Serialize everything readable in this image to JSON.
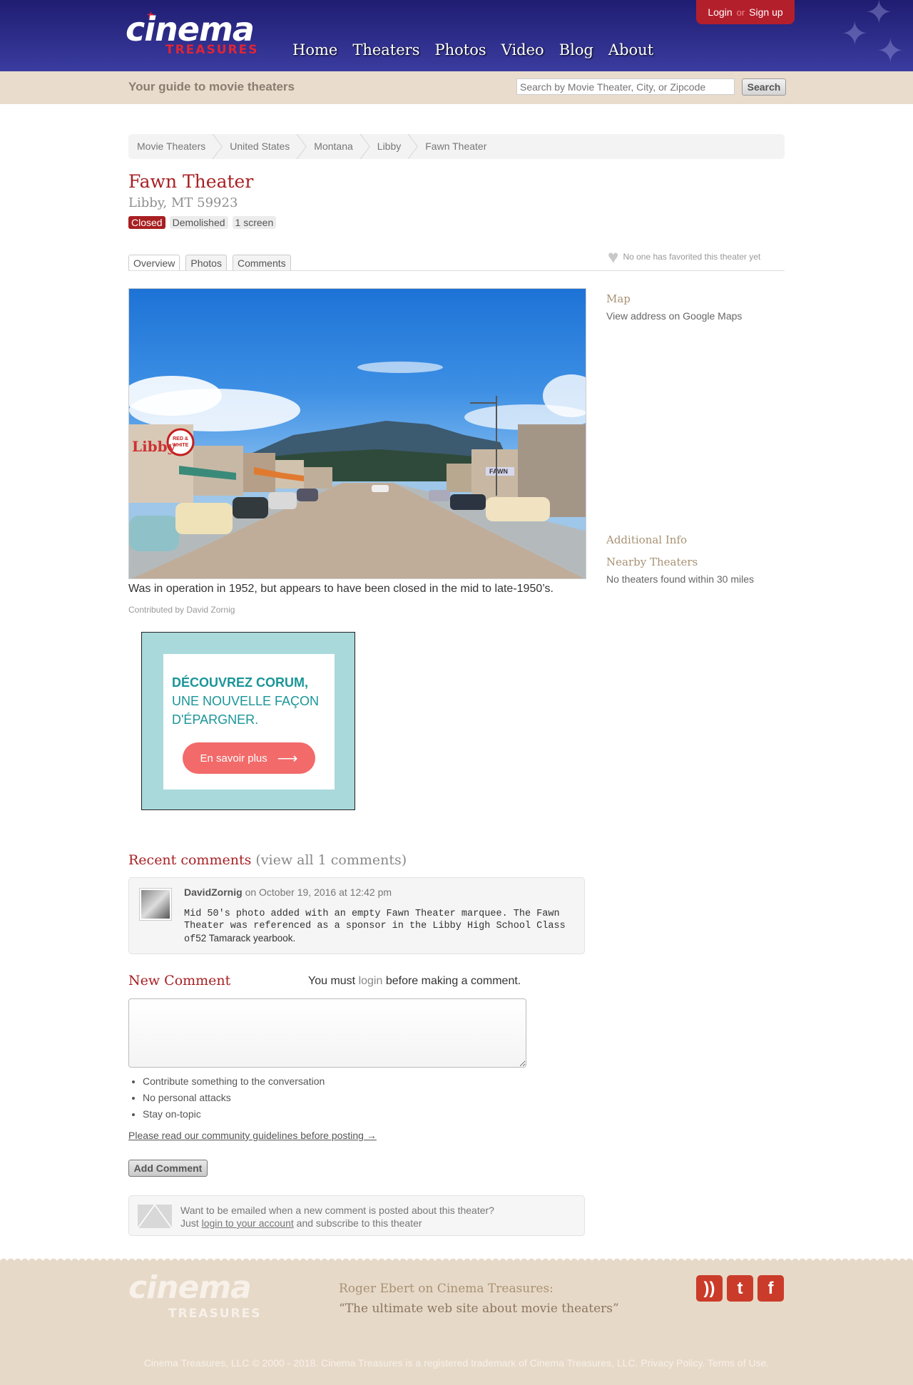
{
  "header": {
    "logo_main": "cinema",
    "logo_sub": "TREASURES",
    "nav": [
      "Home",
      "Theaters",
      "Photos",
      "Video",
      "Blog",
      "About"
    ],
    "login": "Login",
    "or": "or",
    "signup": "Sign up"
  },
  "subheader": {
    "tagline": "Your guide to movie theaters",
    "search_placeholder": "Search by Movie Theater, City, or Zipcode",
    "search_button": "Search"
  },
  "breadcrumb": [
    "Movie Theaters",
    "United States",
    "Montana",
    "Libby",
    "Fawn Theater"
  ],
  "theater": {
    "name": "Fawn Theater",
    "location": "Libby, MT 59923",
    "badges": [
      "Closed",
      "Demolished",
      "1 screen"
    ]
  },
  "tabs": [
    "Overview",
    "Photos",
    "Comments"
  ],
  "favorite_text": "No one has favorited this theater yet",
  "photo": {
    "caption": "Was in operation in 1952, but appears to have been closed in the mid to late-1950’s.",
    "contributor": "Contributed by David Zornig",
    "sign_left": "Libby",
    "sign_store_1": "RED &",
    "sign_store_2": "WHITE",
    "sign_theater": "FAWN"
  },
  "sidebar": {
    "map_title": "Map",
    "map_link": "View address on Google Maps",
    "additional_info": "Additional Info",
    "nearby_title": "Nearby Theaters",
    "nearby_text": "No theaters found within 30 miles"
  },
  "ad": {
    "line1": "DÉCOUVREZ CORUM,",
    "line2": "UNE NOUVELLE FAÇON",
    "line3": "D'ÉPARGNER.",
    "button": "En savoir plus"
  },
  "recent_comments": {
    "title": "Recent comments",
    "view_all": "(view all 1 comments)",
    "items": [
      {
        "author": "DavidZornig",
        "date": "on October 19, 2016 at 12:42 pm",
        "body": "Mid 50's photo added with an empty Fawn Theater marquee. The Fawn Theater was referenced as a sponsor in the Libby High School Class of"
      }
    ],
    "body_tail": "52 Tamarack yearbook."
  },
  "new_comment": {
    "title": "New Comment",
    "msg_before": "You must ",
    "msg_link": "login",
    "msg_after": " before making a comment.",
    "rules": [
      "Contribute something to the conversation",
      "No personal attacks",
      "Stay on-topic"
    ],
    "guidelines": "Please read our community guidelines before posting →",
    "add_button": "Add Comment"
  },
  "notify": {
    "line1": "Want to be emailed when a new comment is posted about this theater?",
    "line2_before": "Just ",
    "line2_link": "login to your account",
    "line2_after": " and subscribe to this theater"
  },
  "footer": {
    "logo_main": "cinema",
    "logo_sub": "TREASURES",
    "quote_attrib": "Roger Ebert on Cinema Treasures:",
    "quote": "“The ultimate web site about movie theaters”",
    "social": [
      "rss-icon",
      "twitter-icon",
      "facebook-icon"
    ],
    "copyright": "Cinema Treasures, LLC © 2000 - 2018. Cinema Treasures is a registered trademark of Cinema Treasures, LLC. Privacy Policy. Terms of Use."
  },
  "colors": {
    "header_blue": "#2b2a8a",
    "accent_red": "#a81f22",
    "tan": "#e7d9c8"
  }
}
